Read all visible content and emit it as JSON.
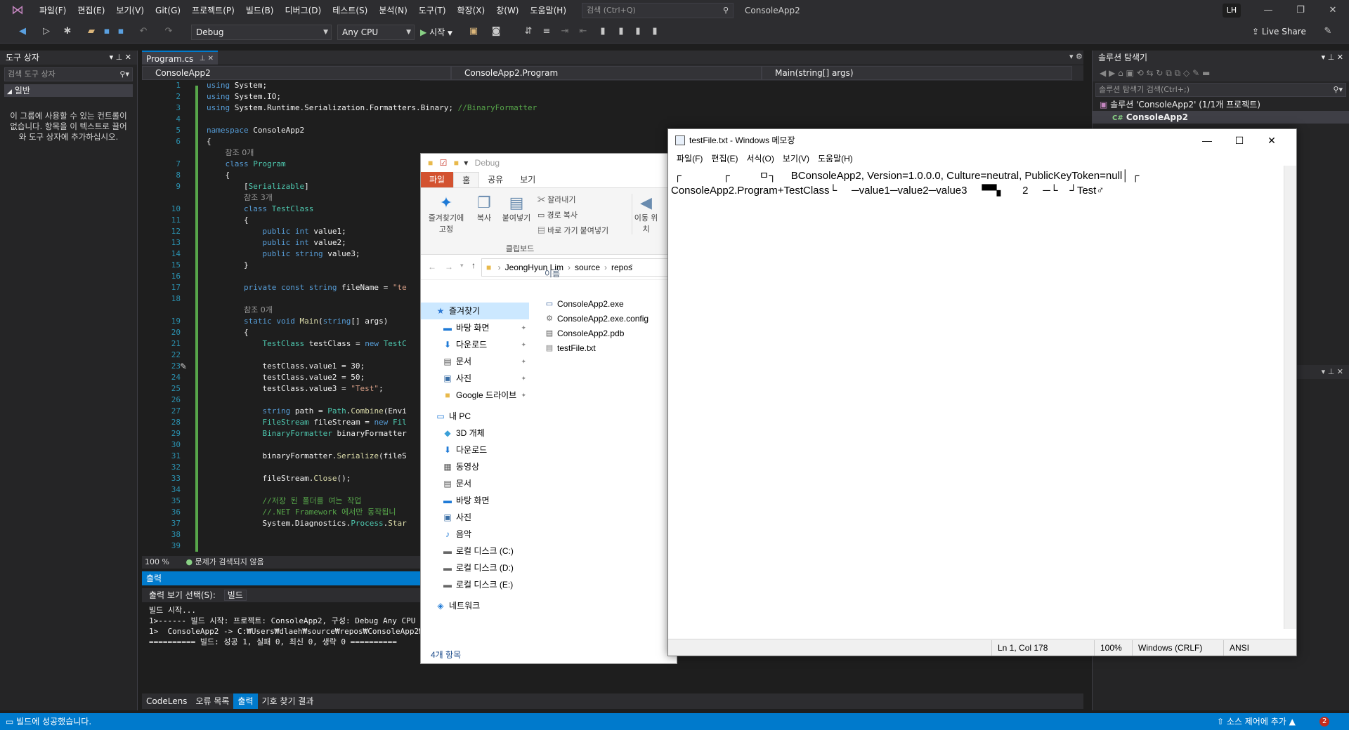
{
  "vs": {
    "menu": [
      "파일(F)",
      "편집(E)",
      "보기(V)",
      "Git(G)",
      "프로젝트(P)",
      "빌드(B)",
      "디버그(D)",
      "테스트(S)",
      "분석(N)",
      "도구(T)",
      "확장(X)",
      "창(W)",
      "도움말(H)"
    ],
    "search_placeholder": "검색 (Ctrl+Q)",
    "app_name": "ConsoleApp2",
    "user_initials": "LH",
    "config": "Debug",
    "platform": "Any CPU",
    "start": "시작",
    "live_share": "Live Share"
  },
  "toolbox": {
    "title": "도구 상자",
    "search": "검색 도구 상자",
    "group": "일반",
    "empty_text": "이 그룹에 사용할 수 있는 컨트롤이 없습니다. 항목을 이 텍스트로 끌어와 도구 상자에 추가하십시오."
  },
  "editor": {
    "tab": "Program.cs",
    "nav_project": "ConsoleApp2",
    "nav_class": "ConsoleApp2.Program",
    "nav_member": "Main(string[] args)",
    "zoom": "100 %",
    "issues": "문제가 검색되지 않음",
    "lines": [
      {
        "n": "1",
        "html": "<span class='kw'>using</span> System;"
      },
      {
        "n": "2",
        "html": "<span class='kw'>using</span> System.IO;"
      },
      {
        "n": "3",
        "html": "<span class='kw'>using</span> System.Runtime.Serialization.Formatters.Binary; <span class='cm'>//BinaryFormatter</span>"
      },
      {
        "n": "4",
        "html": ""
      },
      {
        "n": "5",
        "html": "<span class='kw'>namespace</span> ConsoleApp2"
      },
      {
        "n": "6",
        "html": "{"
      },
      {
        "n": "",
        "html": "    <span class='ref'>참조 0개</span>"
      },
      {
        "n": "7",
        "html": "    <span class='kw'>class</span> <span class='ty'>Program</span>"
      },
      {
        "n": "8",
        "html": "    {"
      },
      {
        "n": "9",
        "html": "        [<span class='at'>Serializable</span>]"
      },
      {
        "n": "",
        "html": "        <span class='ref'>참조 3개</span>"
      },
      {
        "n": "10",
        "html": "        <span class='kw'>class</span> <span class='ty'>TestClass</span>"
      },
      {
        "n": "11",
        "html": "        {"
      },
      {
        "n": "12",
        "html": "            <span class='kw'>public int</span> value1;"
      },
      {
        "n": "13",
        "html": "            <span class='kw'>public int</span> value2;"
      },
      {
        "n": "14",
        "html": "            <span class='kw'>public string</span> value3;"
      },
      {
        "n": "15",
        "html": "        }"
      },
      {
        "n": "16",
        "html": ""
      },
      {
        "n": "17",
        "html": "        <span class='kw'>private const string</span> fileName = <span class='st'>\"te</span>"
      },
      {
        "n": "18",
        "html": ""
      },
      {
        "n": "",
        "html": "        <span class='ref'>참조 0개</span>"
      },
      {
        "n": "19",
        "html": "        <span class='kw'>static void</span> <span class='fn'>Main</span>(<span class='kw'>string</span>[] args)"
      },
      {
        "n": "20",
        "html": "        {"
      },
      {
        "n": "21",
        "html": "            <span class='ty'>TestClass</span> testClass = <span class='kw'>new</span> <span class='ty'>TestC</span>"
      },
      {
        "n": "22",
        "html": ""
      },
      {
        "n": "23",
        "html": "            testClass.value1 = 30;"
      },
      {
        "n": "24",
        "html": "            testClass.value2 = 50;"
      },
      {
        "n": "25",
        "html": "            testClass.value3 = <span class='st'>\"Test\"</span>;"
      },
      {
        "n": "26",
        "html": ""
      },
      {
        "n": "27",
        "html": "            <span class='kw'>string</span> path = <span class='ty'>Path</span>.<span class='fn'>Combine</span>(Envi"
      },
      {
        "n": "28",
        "html": "            <span class='ty'>FileStream</span> fileStream = <span class='kw'>new</span> <span class='ty'>Fil</span>"
      },
      {
        "n": "29",
        "html": "            <span class='ty'>BinaryFormatter</span> binaryFormatter"
      },
      {
        "n": "30",
        "html": ""
      },
      {
        "n": "31",
        "html": "            binaryFormatter.<span class='fn'>Serialize</span>(fileS"
      },
      {
        "n": "32",
        "html": ""
      },
      {
        "n": "33",
        "html": "            fileStream.<span class='fn'>Close</span>();"
      },
      {
        "n": "34",
        "html": ""
      },
      {
        "n": "35",
        "html": "            <span class='cm'>//저장 된 폴더를 여는 작업</span>"
      },
      {
        "n": "36",
        "html": "            <span class='cm'>//.NET Framework 에서만 동작됩니</span>"
      },
      {
        "n": "37",
        "html": "            System.Diagnostics.<span class='ty'>Process</span>.<span class='fn'>Star</span>"
      },
      {
        "n": "38",
        "html": ""
      },
      {
        "n": "39",
        "html": ""
      }
    ]
  },
  "output": {
    "title": "출력",
    "source_label": "출력 보기 선택(S):",
    "source_value": "빌드",
    "lines": [
      "빌드 시작...",
      "1>------ 빌드 시작: 프로젝트: ConsoleApp2, 구성: Debug Any CPU -",
      "1>  ConsoleApp2 -> C:₩Users₩dlaeh₩source₩repos₩ConsoleApp2₩Conso",
      "========== 빌드: 성공 1, 실패 0, 최신 0, 생략 0 =========="
    ],
    "tabs": [
      "CodeLens",
      "오류 목록",
      "출력",
      "기호 찾기 결과"
    ]
  },
  "solution": {
    "title": "솔루션 탐색기",
    "search": "솔루션 탐색기 검색(Ctrl+;)",
    "root": "솔루션 'ConsoleApp2' (1/1개 프로젝트)",
    "project": "ConsoleApp2"
  },
  "statusbar": {
    "message": "빌드에 성공했습니다.",
    "source_control": "소스 제어에 추가",
    "notifications": "2"
  },
  "explorer": {
    "qat_path": "Debug",
    "tabs": [
      "파일",
      "홈",
      "공유",
      "보기"
    ],
    "ribbon": {
      "pin": "즐겨찾기에 고정",
      "copy": "복사",
      "paste": "붙여넣기",
      "cut": "잘라내기",
      "copy_path": "경로 복사",
      "paste_shortcut": "바로 가기 붙여넣기",
      "group_label": "클립보드",
      "move": "이동 위치"
    },
    "breadcrumb": [
      "JeongHyun Lim",
      "source",
      "repos"
    ],
    "col_name": "이름",
    "nav": [
      {
        "label": "즐겨찾기",
        "icon": "★",
        "color": "#2b78d4",
        "pin": false,
        "sel": true,
        "indent": 0
      },
      {
        "label": "바탕 화면",
        "icon": "▬",
        "color": "#1f7ad6",
        "pin": true,
        "indent": 1
      },
      {
        "label": "다운로드",
        "icon": "⬇",
        "color": "#1f7ad6",
        "pin": true,
        "indent": 1
      },
      {
        "label": "문서",
        "icon": "▤",
        "color": "#555",
        "pin": true,
        "indent": 1
      },
      {
        "label": "사진",
        "icon": "▣",
        "color": "#3a6ea5",
        "pin": true,
        "indent": 1
      },
      {
        "label": "Google 드라이브",
        "icon": "■",
        "color": "#e8b94b",
        "pin": true,
        "indent": 1
      },
      {
        "label": "내 PC",
        "icon": "▭",
        "color": "#1f7ad6",
        "pin": false,
        "indent": 0
      },
      {
        "label": "3D 개체",
        "icon": "◆",
        "color": "#3aa0d8",
        "pin": false,
        "indent": 1
      },
      {
        "label": "다운로드",
        "icon": "⬇",
        "color": "#1f7ad6",
        "pin": false,
        "indent": 1
      },
      {
        "label": "동영상",
        "icon": "▦",
        "color": "#555",
        "pin": false,
        "indent": 1
      },
      {
        "label": "문서",
        "icon": "▤",
        "color": "#555",
        "pin": false,
        "indent": 1
      },
      {
        "label": "바탕 화면",
        "icon": "▬",
        "color": "#1f7ad6",
        "pin": false,
        "indent": 1
      },
      {
        "label": "사진",
        "icon": "▣",
        "color": "#3a6ea5",
        "pin": false,
        "indent": 1
      },
      {
        "label": "음악",
        "icon": "♪",
        "color": "#1f7ad6",
        "pin": false,
        "indent": 1
      },
      {
        "label": "로컬 디스크 (C:)",
        "icon": "▬",
        "color": "#666",
        "pin": false,
        "indent": 1
      },
      {
        "label": "로컬 디스크 (D:)",
        "icon": "▬",
        "color": "#666",
        "pin": false,
        "indent": 1
      },
      {
        "label": "로컬 디스크 (E:)",
        "icon": "▬",
        "color": "#666",
        "pin": false,
        "indent": 1
      },
      {
        "label": "네트워크",
        "icon": "◈",
        "color": "#1f7ad6",
        "pin": false,
        "indent": 0
      }
    ],
    "files": [
      {
        "name": "ConsoleApp2.exe",
        "icon": "▭",
        "color": "#2b5797"
      },
      {
        "name": "ConsoleApp2.exe.config",
        "icon": "⚙",
        "color": "#666"
      },
      {
        "name": "ConsoleApp2.pdb",
        "icon": "▤",
        "color": "#555"
      },
      {
        "name": "testFile.txt",
        "icon": "▤",
        "color": "#777"
      }
    ],
    "count": "4개 항목"
  },
  "notepad": {
    "title": "testFile.txt - Windows 메모장",
    "menu": [
      "파일(F)",
      "편집(E)",
      "서식(O)",
      "보기(V)",
      "도움말(H)"
    ],
    "line1": " ┌              ┌          ㅁ┐     BConsoleApp2, Version=1.0.0.0, Culture=neutral, PublicKeyToken=null│ ┌",
    "line2": "ConsoleApp2.Program+TestClass└     ─value1─value2─value3     ▀▀▖      2     ─└    ┘Test♂",
    "position": "Ln 1, Col 178",
    "zoom": "100%",
    "eol": "Windows (CRLF)",
    "encoding": "ANSI"
  }
}
